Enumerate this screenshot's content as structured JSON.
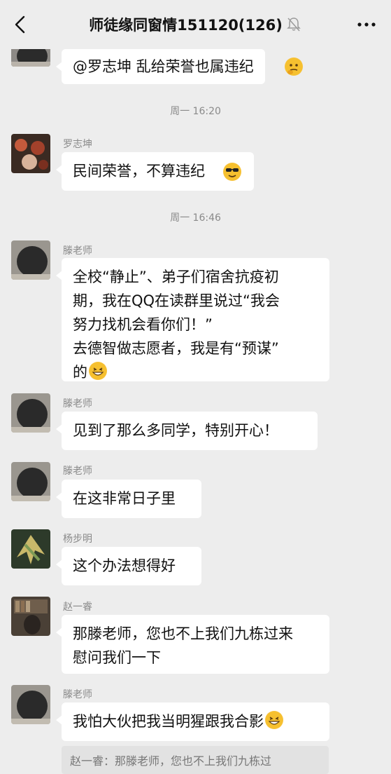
{
  "header": {
    "title": "师徒缘同窗情151120(126)",
    "back_icon": "chevron-left-icon",
    "mute_icon": "bell-off-icon",
    "more_icon": "more-dots-icon"
  },
  "messages": [
    {
      "sender": "",
      "lines": [
        "@罗志坤  乱给荣誉也属违纪"
      ],
      "emoji": "thinking-face-emoji"
    },
    {
      "timestamp": "周一 16:20"
    },
    {
      "sender": "罗志坤",
      "lines": [
        "民间荣誉，不算违纪"
      ],
      "emoji": "sunglasses-face-emoji"
    },
    {
      "timestamp": "周一 16:46"
    },
    {
      "sender": "滕老师",
      "lines": [
        "全校“静止”、弟子们宿舍抗疫初",
        "期，我在QQ在读群里说过“我会",
        "努力找机会看你们！”",
        "去德智做志愿者，我是有“预谋”",
        "的"
      ],
      "emoji": "grinning-face-emoji"
    },
    {
      "sender": "滕老师",
      "lines": [
        "见到了那么多同学，特别开心！"
      ]
    },
    {
      "sender": "滕老师",
      "lines": [
        "在这非常日子里"
      ]
    },
    {
      "sender": "杨步明",
      "lines": [
        "这个办法想得好"
      ]
    },
    {
      "sender": "赵一睿",
      "lines": [
        "那滕老师，您也不上我们九栋过来",
        "慰问我们一下"
      ]
    },
    {
      "sender": "滕老师",
      "lines": [
        "我怕大伙把我当明猩跟我合影"
      ],
      "emoji": "grinning-face-emoji"
    }
  ],
  "quote_preview": "赵一睿：那滕老师，您也不上我们九栋过"
}
